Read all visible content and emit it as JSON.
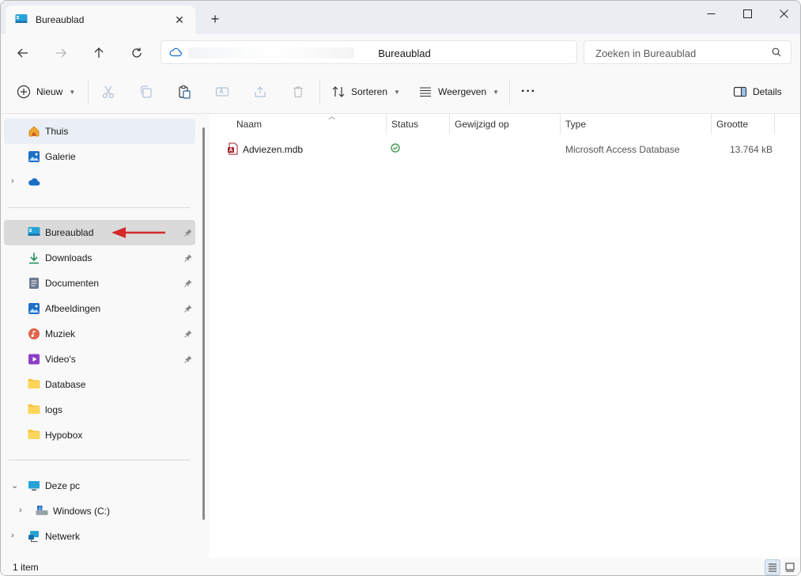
{
  "window": {
    "tab_title": "Bureaublad",
    "tab_close": "✕",
    "new_tab": "+"
  },
  "address": {
    "path": "Bureaublad",
    "search_placeholder": "Zoeken in Bureaublad"
  },
  "toolbar": {
    "new_label": "Nieuw",
    "sort_label": "Sorteren",
    "view_label": "Weergeven",
    "more_label": "···",
    "details_label": "Details"
  },
  "sidebar": {
    "items": [
      {
        "label": "Thuis"
      },
      {
        "label": "Galerie"
      },
      {
        "label": ""
      },
      {
        "label": "Bureaublad"
      },
      {
        "label": "Downloads"
      },
      {
        "label": "Documenten"
      },
      {
        "label": "Afbeeldingen"
      },
      {
        "label": "Muziek"
      },
      {
        "label": "Video's"
      },
      {
        "label": "Database"
      },
      {
        "label": "logs"
      },
      {
        "label": "Hypobox"
      },
      {
        "label": "Deze pc"
      },
      {
        "label": "Windows  (C:)"
      },
      {
        "label": "Netwerk"
      }
    ]
  },
  "columns": {
    "name": "Naam",
    "status": "Status",
    "modified": "Gewijzigd op",
    "type": "Type",
    "size": "Grootte"
  },
  "files": [
    {
      "name": "Adviezen.mdb",
      "type": "Microsoft Access Database",
      "size": "13.764 kB"
    }
  ],
  "statusbar": {
    "count": "1 item"
  },
  "colors": {
    "accent": "#0067c0",
    "folder": "#f5c542",
    "arrow": "#d42a2a",
    "status_ok": "#2e8b3a"
  }
}
